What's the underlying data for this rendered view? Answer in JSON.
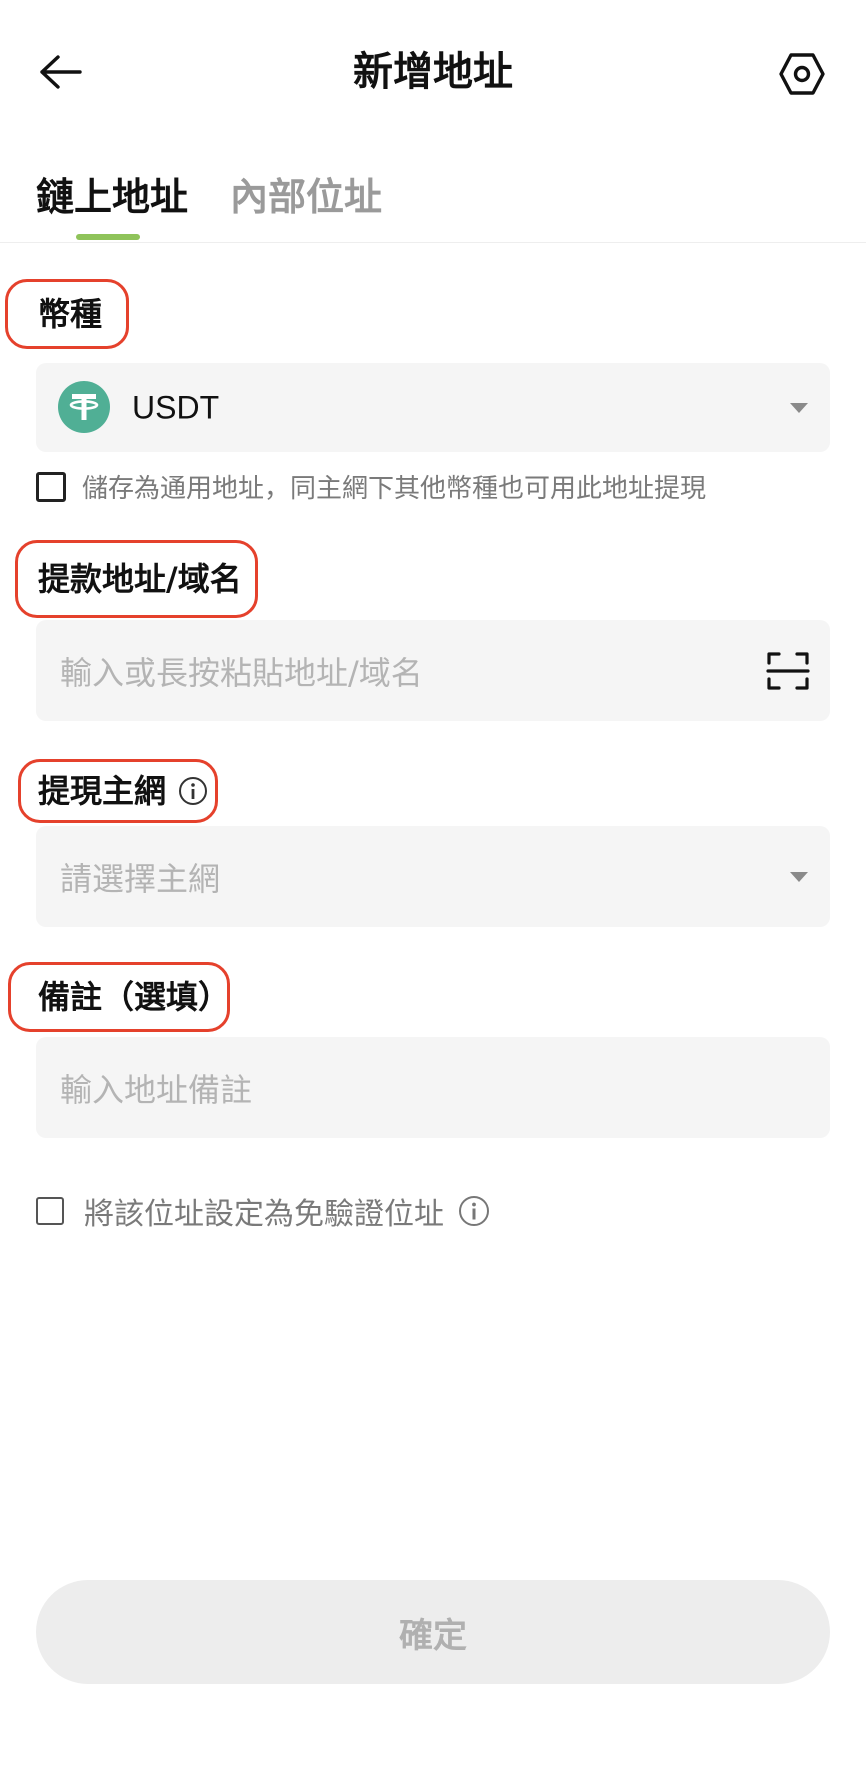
{
  "header": {
    "title": "新增地址",
    "back_icon": "arrow-left-icon",
    "settings_icon": "hexagon-gear-icon"
  },
  "tabs": [
    {
      "label": "鏈上地址",
      "active": true
    },
    {
      "label": "內部位址",
      "active": false
    }
  ],
  "coin": {
    "label": "幣種",
    "selected": "USDT",
    "logo_icon": "tether-icon",
    "logo_color": "#50AF95"
  },
  "universal_address": {
    "label": "儲存為通用地址，同主網下其他幣種也可用此地址提現",
    "checked": false
  },
  "withdraw_address": {
    "label": "提款地址/域名",
    "placeholder": "輸入或長按粘貼地址/域名",
    "scan_icon": "scan-icon"
  },
  "network": {
    "label": "提現主網",
    "placeholder": "請選擇主網",
    "info_icon": "info-icon"
  },
  "note": {
    "label": "備註（選填）",
    "placeholder": "輸入地址備註"
  },
  "verification_free": {
    "label": "將該位址設定為免驗證位址",
    "checked": false,
    "info_icon": "info-icon"
  },
  "confirm_label": "確定",
  "colors": {
    "accent": "#8FC35A",
    "highlight": "#E5412C",
    "field_bg": "#F5F5F5",
    "disabled_button": "#EDEDED"
  }
}
